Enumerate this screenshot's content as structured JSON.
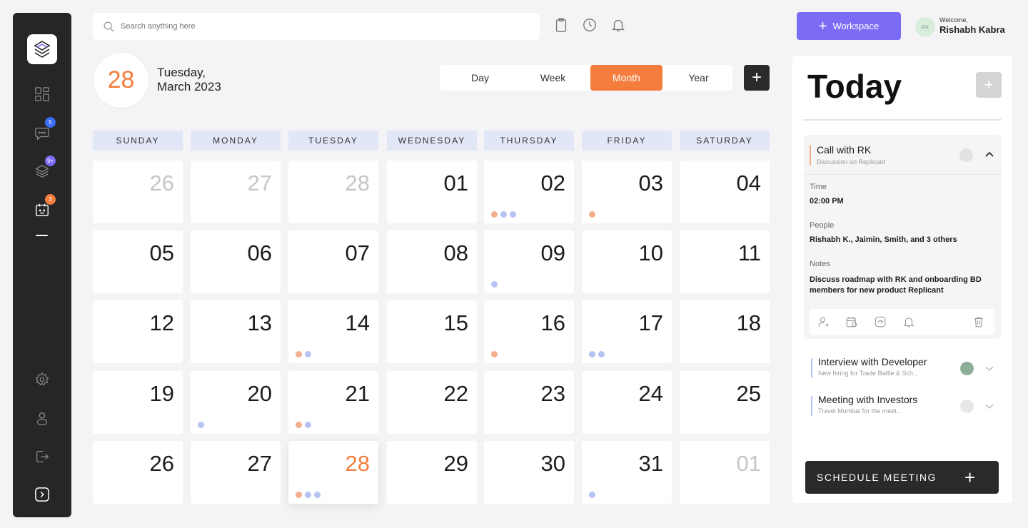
{
  "colors": {
    "accent": "#f47c3c",
    "primary": "#7c6cf5",
    "dot_orange": "#f4ae8e",
    "dot_blue": "#b6c3f2",
    "weekday_bg": "#e2e7f8",
    "sidebar": "#262626"
  },
  "sidebar": {
    "logo_icon": "layers-logo-icon",
    "items": [
      {
        "name": "dashboard-icon",
        "badge": ""
      },
      {
        "name": "chat-icon",
        "badge": "5",
        "badge_color": "#3b6cf5"
      },
      {
        "name": "stack-icon",
        "badge": "9+",
        "badge_color": "#7c6cf5"
      },
      {
        "name": "calendar-icon",
        "badge": "3",
        "badge_color": "#f47c3c"
      }
    ],
    "bottom": [
      "settings-icon",
      "user-icon",
      "logout-icon",
      "expand-icon"
    ]
  },
  "search": {
    "placeholder": "Search anything here"
  },
  "top_icons": [
    "clipboard-icon",
    "clock-icon",
    "bell-icon"
  ],
  "workspace_button": {
    "label": "Workspace"
  },
  "user": {
    "initials": "RK",
    "welcome": "Welcome,",
    "name": "Rishabh Kabra"
  },
  "date": {
    "day": "28",
    "weekday": "Tuesday,",
    "month_year": "March 2023"
  },
  "views": {
    "day": "Day",
    "week": "Week",
    "month": "Month",
    "year": "Year",
    "active": "Month"
  },
  "calendar": {
    "weekdays": [
      "SUNDAY",
      "MONDAY",
      "TUESDAY",
      "WEDNESDAY",
      "THURSDAY",
      "FRIDAY",
      "SATURDAY"
    ],
    "weeks": [
      [
        {
          "d": "26",
          "muted": true,
          "dots": []
        },
        {
          "d": "27",
          "muted": true,
          "dots": []
        },
        {
          "d": "28",
          "muted": true,
          "dots": []
        },
        {
          "d": "01",
          "dots": []
        },
        {
          "d": "02",
          "dots": [
            "orange",
            "blue",
            "blue"
          ]
        },
        {
          "d": "03",
          "dots": [
            "orange"
          ]
        },
        {
          "d": "04",
          "dots": []
        }
      ],
      [
        {
          "d": "05",
          "dots": []
        },
        {
          "d": "06",
          "dots": []
        },
        {
          "d": "07",
          "dots": []
        },
        {
          "d": "08",
          "dots": []
        },
        {
          "d": "09",
          "dots": [
            "blue"
          ]
        },
        {
          "d": "10",
          "dots": []
        },
        {
          "d": "11",
          "dots": []
        }
      ],
      [
        {
          "d": "12",
          "dots": []
        },
        {
          "d": "13",
          "dots": []
        },
        {
          "d": "14",
          "dots": [
            "orange",
            "blue"
          ]
        },
        {
          "d": "15",
          "dots": []
        },
        {
          "d": "16",
          "dots": [
            "orange"
          ]
        },
        {
          "d": "17",
          "dots": [
            "blue",
            "blue"
          ]
        },
        {
          "d": "18",
          "dots": []
        }
      ],
      [
        {
          "d": "19",
          "dots": []
        },
        {
          "d": "20",
          "dots": [
            "blue"
          ]
        },
        {
          "d": "21",
          "dots": [
            "orange",
            "blue"
          ]
        },
        {
          "d": "22",
          "dots": []
        },
        {
          "d": "23",
          "dots": []
        },
        {
          "d": "24",
          "dots": []
        },
        {
          "d": "25",
          "dots": []
        }
      ],
      [
        {
          "d": "26",
          "dots": []
        },
        {
          "d": "27",
          "dots": []
        },
        {
          "d": "28",
          "today": true,
          "dots": [
            "orange",
            "blue",
            "blue"
          ]
        },
        {
          "d": "29",
          "dots": []
        },
        {
          "d": "30",
          "dots": []
        },
        {
          "d": "31",
          "dots": [
            "blue"
          ]
        },
        {
          "d": "01",
          "muted": true,
          "dots": []
        }
      ]
    ]
  },
  "today_panel": {
    "title": "Today",
    "expanded_event": {
      "title": "Call with RK",
      "subtitle": "Discussion on Replicant",
      "bar_color": "#f4ae8e",
      "time_label": "Time",
      "time": "02:00 PM",
      "people_label": "People",
      "people": "Rishabh K., Jaimin, Smith, and 3 others",
      "notes_label": "Notes",
      "notes": "Discuss roadmap with RK and onboarding BD members for new product Replicant",
      "actions": [
        "add-person-icon",
        "calendar-edit-icon",
        "share-icon",
        "bell-icon",
        "delete-icon"
      ]
    },
    "events": [
      {
        "title": "Interview with Developer",
        "subtitle": "New hiring for Trade Battle & Sch...",
        "status_color": "#8fae9a"
      },
      {
        "title": "Meeting with Investors",
        "subtitle": "Travel Mumbai for the meet...",
        "status_color": "#e8e8e8"
      }
    ],
    "schedule_button": "SCHEDULE MEETING"
  }
}
